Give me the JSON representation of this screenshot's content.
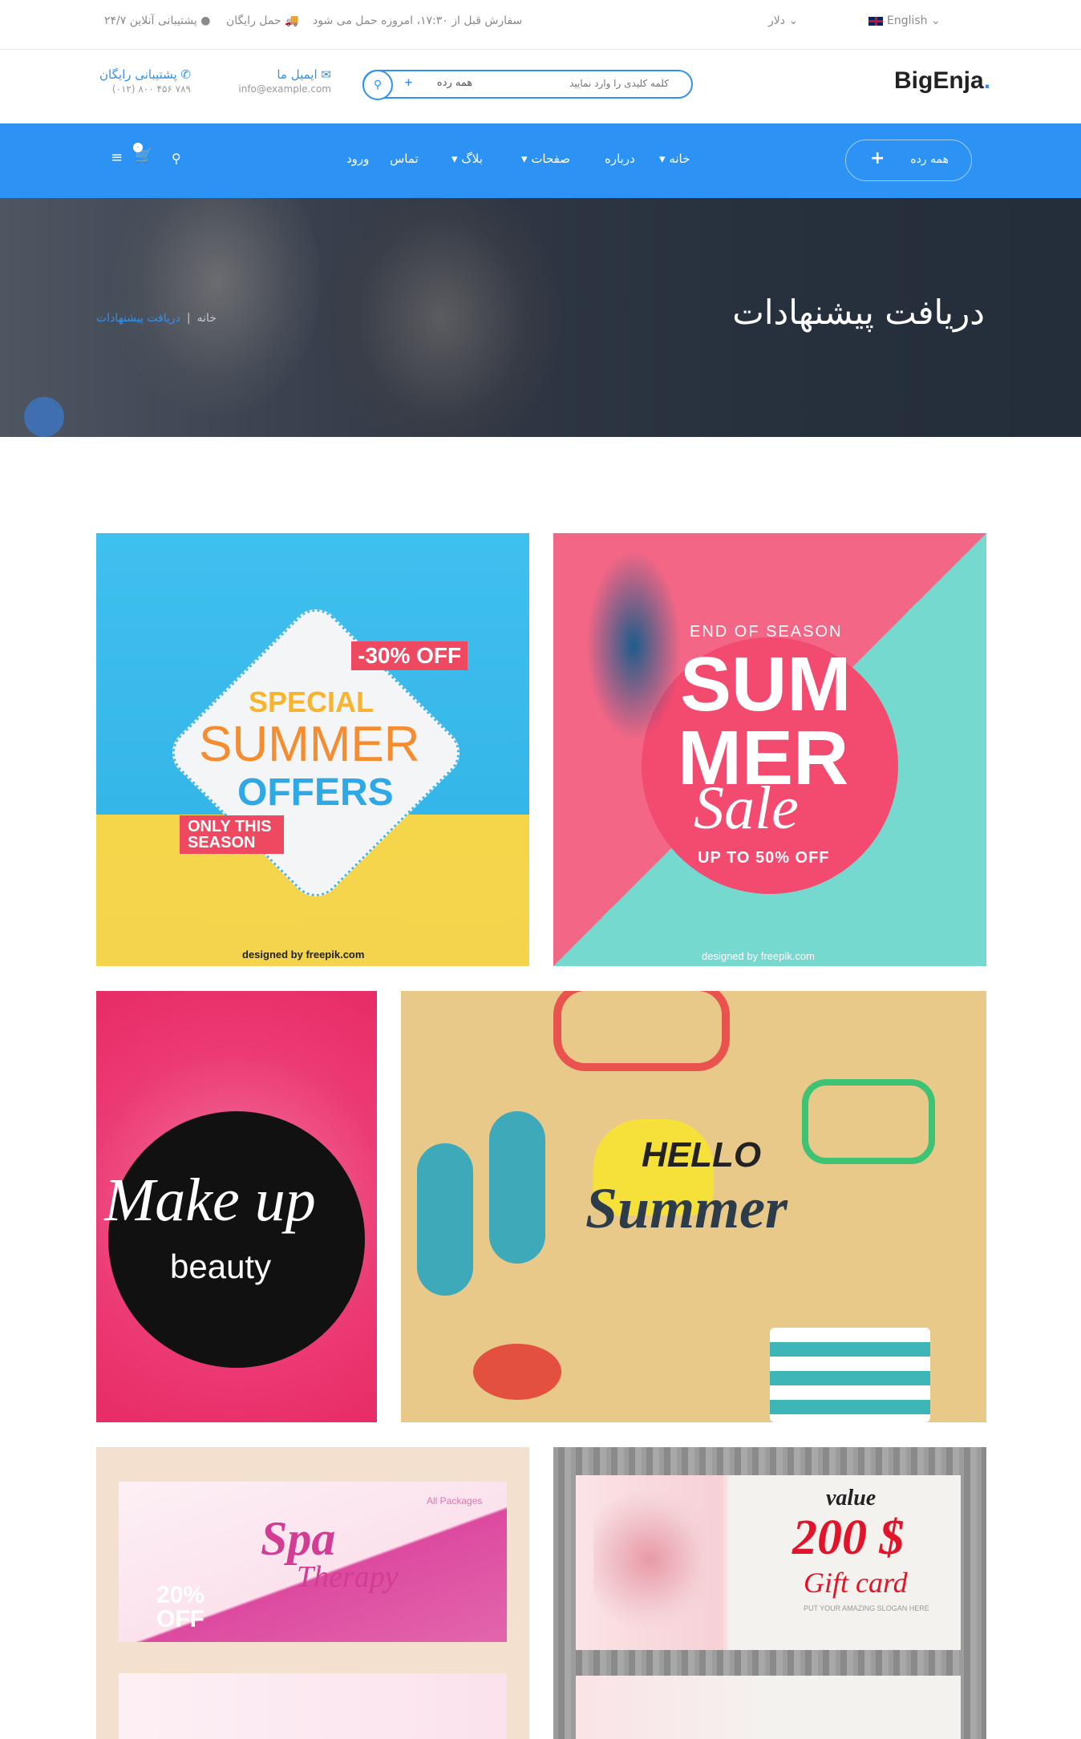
{
  "topbar": {
    "language": "English",
    "currency": "دلار",
    "order_notice": "سفارش قبل از ۱۷:۳۰، امروزه حمل می شود",
    "free_shipping": "حمل رایگان",
    "support": "۲۴/۷ پشتیبانی آنلاین"
  },
  "header": {
    "logo": "BigEnja",
    "logo_dot": ".",
    "search_category": "همه رده",
    "search_placeholder": "کلمه کلیدی را وارد نمایید",
    "email_title": "ایمیل ما",
    "email_value": "info@example.com",
    "phone_title": "پشتیبانی رایگان",
    "phone_value": "(۰۱۲) ۸۰۰ ۴۵۶ ۷۸۹"
  },
  "nav": {
    "all_categories": "همه رده",
    "items": [
      "خانه",
      "درباره",
      "صفحات",
      "بلاگ",
      "تماس",
      "ورود"
    ],
    "cart_count": "۰"
  },
  "hero": {
    "title": "دریافت پیشنهادات",
    "breadcrumb_home": "خانه",
    "breadcrumb_current": "دریافت پیشنهادات"
  },
  "offers": [
    {
      "lines": [
        "SPECIAL",
        "SUMMER",
        "OFFERS"
      ],
      "badge": "-30% OFF",
      "sub": "ONLY THIS SEASON",
      "credit": "designed by freepik.com"
    },
    {
      "lines": [
        "END OF SEASON",
        "SUM",
        "MER",
        "Sale"
      ],
      "sub": "UP TO 50% OFF",
      "credit": "designed by freepik.com"
    },
    {
      "lines": [
        "Make up",
        "beauty"
      ]
    },
    {
      "lines": [
        "HELLO",
        "Summer"
      ]
    },
    {
      "lines": [
        "Spa",
        "Therapy"
      ],
      "sub": "20%",
      "sub2": "OFF",
      "note": "All Packages"
    },
    {
      "lines": [
        "value",
        "200 $",
        "Gift card"
      ],
      "note": "PUT YOUR AMAZING SLOGAN HERE"
    }
  ],
  "colors": {
    "brand": "#2c93f5",
    "hero_bg": "#2a3240"
  }
}
